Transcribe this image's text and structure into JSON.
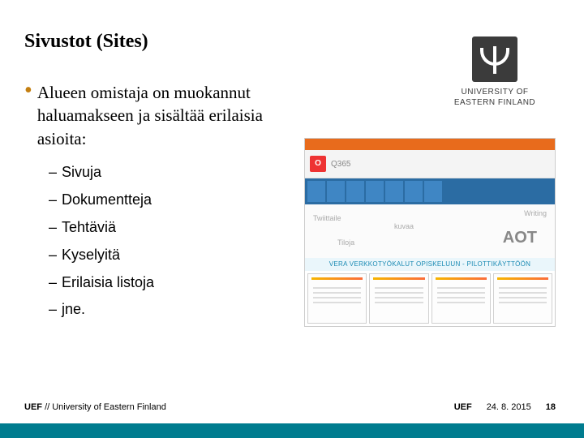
{
  "title": "Sivustot (Sites)",
  "logo": {
    "line1": "UNIVERSITY OF",
    "line2": "EASTERN FINLAND"
  },
  "main_bullet": "Alueen omistaja on muokannut haluamakseen ja sisältää erilaisia asioita:",
  "sub_items": [
    "Sivuja",
    "Dokumentteja",
    "Tehtäviä",
    "Kyselyitä",
    "Erilaisia listoja",
    "jne."
  ],
  "screenshot": {
    "o365_badge": "O",
    "o365_label": "Q365",
    "wordcloud": [
      "Twiittaile",
      "Writing",
      "Tiloja",
      "kuvaa"
    ],
    "aot_label": "AOT",
    "banner": "VERA VERKKOTYÖKALUT OPISKELUUN - PILOTTIKÄYTTÖÖN"
  },
  "footer": {
    "brand": "UEF",
    "inst": "// University of Eastern Finland",
    "brand_right": "UEF",
    "date": "24. 8. 2015",
    "page": "18"
  }
}
